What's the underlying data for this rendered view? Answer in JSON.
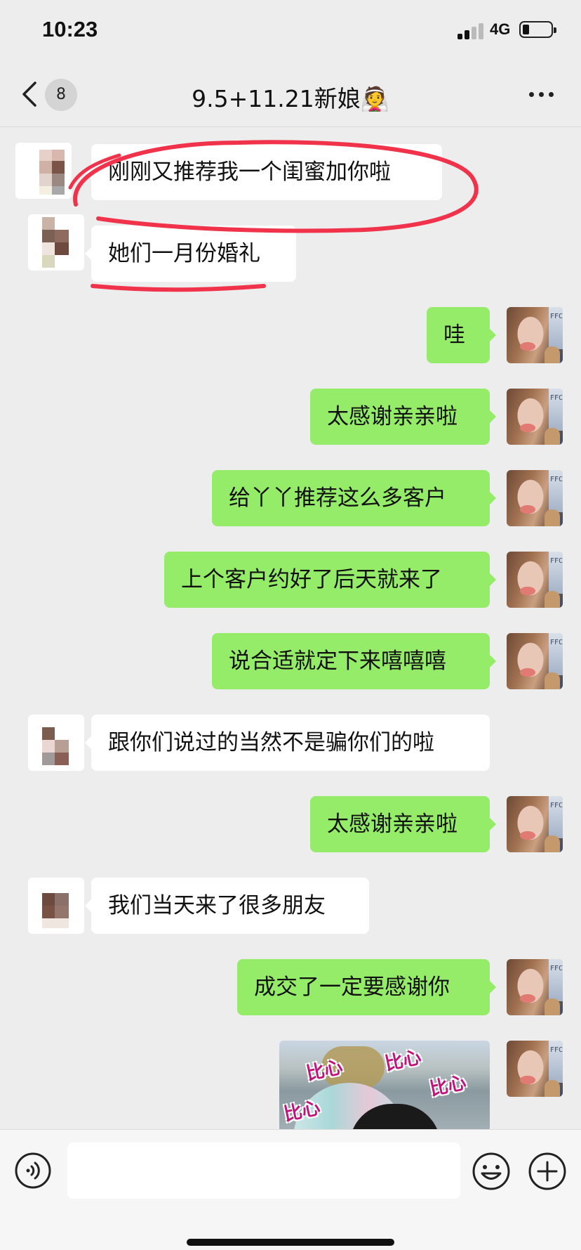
{
  "status_bar": {
    "time": "10:23",
    "network": "4G"
  },
  "header": {
    "unread_count": "8",
    "title": "9.5+11.21新娘👰"
  },
  "messages": [
    {
      "side": "in",
      "text": "刚刚又推荐我一个闺蜜加你啦"
    },
    {
      "side": "in",
      "text": "她们一月份婚礼"
    },
    {
      "side": "out",
      "text": "哇"
    },
    {
      "side": "out",
      "text": "太感谢亲亲啦"
    },
    {
      "side": "out",
      "text": "给丫丫推荐这么多客户"
    },
    {
      "side": "out",
      "text": "上个客户约好了后天就来了"
    },
    {
      "side": "out",
      "text": "说合适就定下来嘻嘻嘻"
    },
    {
      "side": "in",
      "text": "跟你们说过的当然不是骗你们的啦"
    },
    {
      "side": "out",
      "text": "太感谢亲亲啦"
    },
    {
      "side": "in",
      "text": "我们当天来了很多朋友"
    },
    {
      "side": "out",
      "text": "成交了一定要感谢你"
    }
  ],
  "sticker": {
    "words": [
      "比心",
      "比心",
      "比心",
      "比心"
    ]
  },
  "colors": {
    "outgoing_bubble": "#95ec69",
    "incoming_bubble": "#ffffff",
    "background": "#ededed",
    "annotation": "#f0334a"
  }
}
